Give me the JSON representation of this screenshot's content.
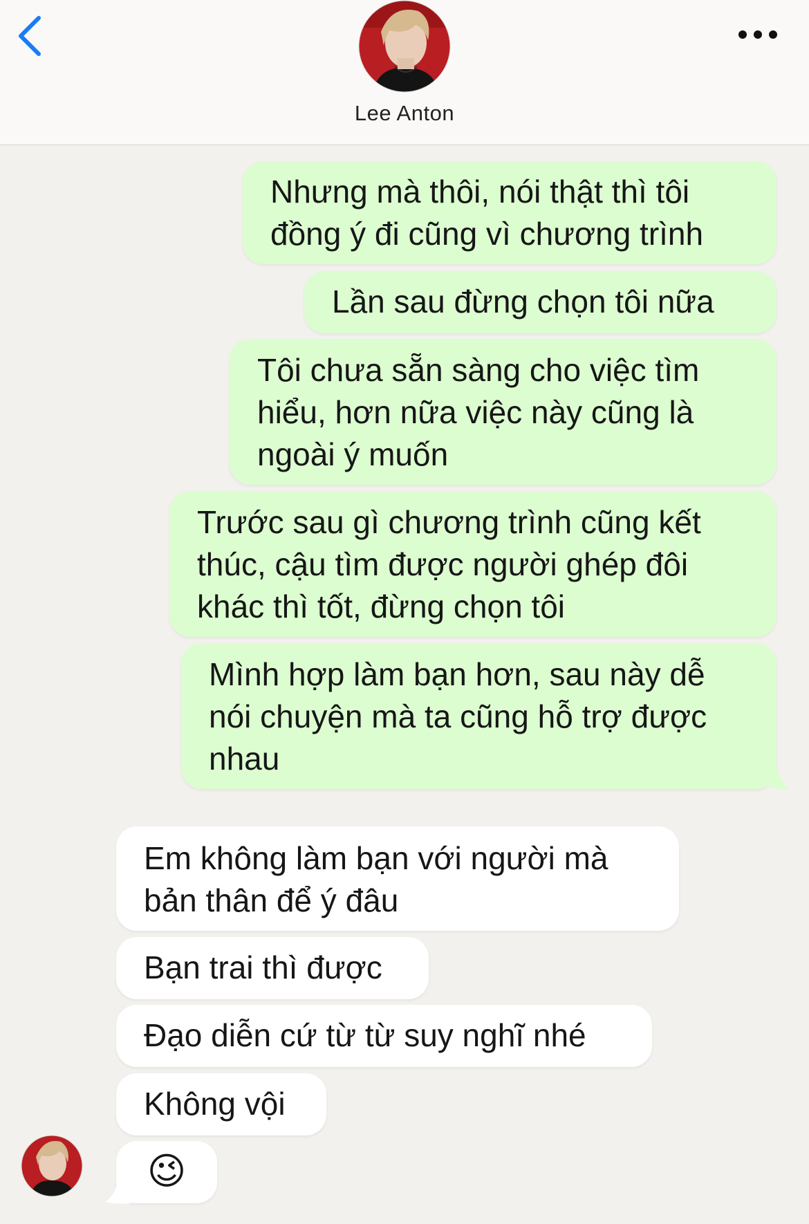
{
  "header": {
    "contact_name": "Lee Anton"
  },
  "messages": [
    {
      "direction": "outgoing",
      "text": "Nhưng mà thôi, nói thật thì tôi đồng ý đi cũng vì chương trình"
    },
    {
      "direction": "outgoing",
      "text": "Lần sau đừng chọn tôi nữa"
    },
    {
      "direction": "outgoing",
      "text": "Tôi chưa sẵn sàng cho việc tìm hiểu, hơn nữa việc này cũng là ngoài ý muốn"
    },
    {
      "direction": "outgoing",
      "text": "Trước sau gì chương trình cũng kết thúc, cậu tìm được người ghép đôi khác thì tốt, đừng chọn tôi"
    },
    {
      "direction": "outgoing",
      "text": "Mình hợp làm bạn hơn, sau này dễ nói chuyện mà ta cũng hỗ trợ được nhau"
    },
    {
      "direction": "incoming",
      "text": "Em không làm bạn với người mà bản thân để ý đâu"
    },
    {
      "direction": "incoming",
      "text": "Bạn trai thì được"
    },
    {
      "direction": "incoming",
      "text": "Đạo diễn cứ từ từ suy nghĩ nhé"
    },
    {
      "direction": "incoming",
      "text": "Không vội"
    },
    {
      "direction": "incoming",
      "text": "😉"
    }
  ],
  "icons": {
    "back": "chevron-left-icon",
    "more": "more-horizontal-icon",
    "avatar": "contact-avatar"
  },
  "colors": {
    "accent": "#1a7cf5",
    "outgoing_bubble": "#dcfdd0",
    "incoming_bubble": "#ffffff",
    "background": "#f3f1ee"
  }
}
